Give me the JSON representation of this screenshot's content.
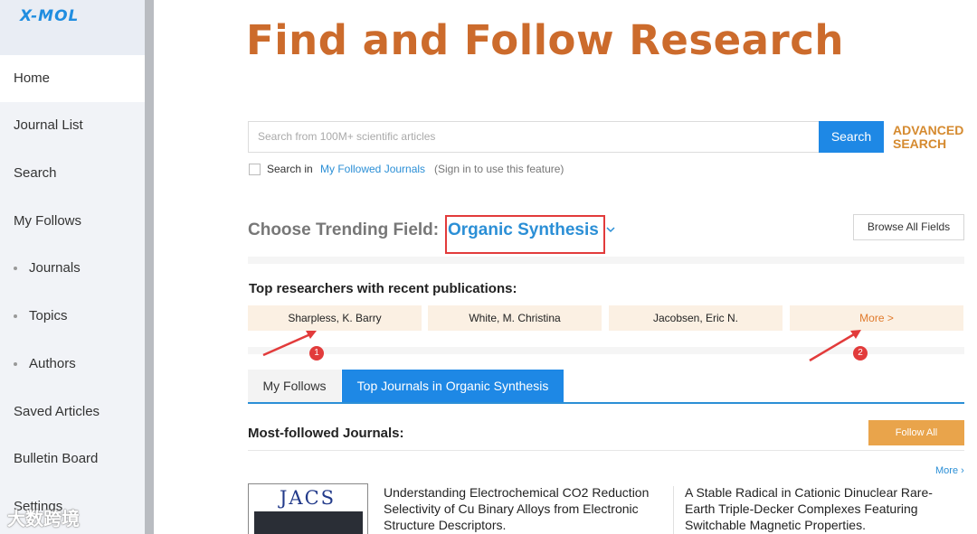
{
  "brand": {
    "logo": "X-MOL"
  },
  "sidebar": {
    "items": [
      {
        "label": "Home",
        "active": true
      },
      {
        "label": "Journal List"
      },
      {
        "label": "Search"
      },
      {
        "label": "My Follows"
      },
      {
        "label": "Journals",
        "sub": true
      },
      {
        "label": "Topics",
        "sub": true
      },
      {
        "label": "Authors",
        "sub": true
      },
      {
        "label": "Saved Articles"
      },
      {
        "label": "Bulletin Board"
      },
      {
        "label": "Settings"
      }
    ]
  },
  "watermark": "大数跨境",
  "headline": "Find and Follow Research",
  "search": {
    "placeholder": "Search from 100M+ scientific articles",
    "button_label": "Search",
    "advanced_label_line1": "ADVANCED",
    "advanced_label_line2": "SEARCH",
    "search_in_label": "Search in",
    "search_in_link": "My Followed Journals",
    "search_in_note": "(Sign in to use this feature)"
  },
  "trending": {
    "label": "Choose Trending Field:",
    "field": "Organic Synthesis",
    "browse_label": "Browse All Fields"
  },
  "researchers": {
    "title": "Top researchers with recent publications:",
    "names": [
      "Sharpless, K. Barry",
      "White, M. Christina",
      "Jacobsen, Eric N."
    ],
    "more_label": "More >"
  },
  "annotations": {
    "badge1": "1",
    "badge2": "2"
  },
  "tabs": [
    {
      "label": "My Follows"
    },
    {
      "label": "Top Journals in Organic Synthesis",
      "active": true
    }
  ],
  "journals": {
    "title": "Most-followed Journals:",
    "follow_all_label": "Follow All",
    "more_label": "More ›",
    "cover_text": "JACS",
    "articles": [
      {
        "line1": "Understanding Electrochemical CO2 Reduction",
        "line2": "Selectivity of Cu Binary Alloys from Electronic",
        "line3": "Structure Descriptors."
      },
      {
        "line1": "A Stable Radical in Cationic Dinuclear Rare-",
        "line2": "Earth Triple-Decker Complexes Featuring",
        "line3": "Switchable Magnetic Properties."
      }
    ]
  },
  "colors": {
    "accent": "#1e88e5",
    "headline": "#cc6b2c",
    "highlight": "#e23b3b",
    "follow_all": "#e9a44b"
  }
}
